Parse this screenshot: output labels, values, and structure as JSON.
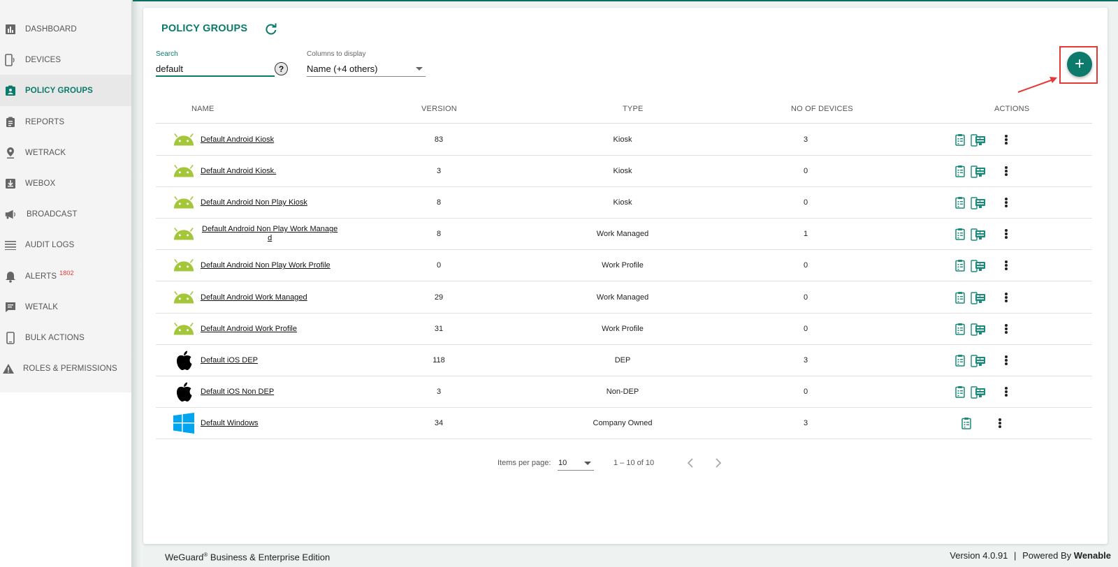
{
  "sidebar": {
    "items": [
      {
        "label": "DASHBOARD",
        "icon": "dashboard-icon"
      },
      {
        "label": "DEVICES",
        "icon": "devices-icon"
      },
      {
        "label": "POLICY GROUPS",
        "icon": "policy-groups-icon",
        "active": true
      },
      {
        "label": "REPORTS",
        "icon": "reports-icon"
      },
      {
        "label": "WETRACK",
        "icon": "location-pin-icon"
      },
      {
        "label": "WEBOX",
        "icon": "download-box-icon"
      },
      {
        "label": "BROADCAST",
        "icon": "megaphone-icon"
      },
      {
        "label": "AUDIT LOGS",
        "icon": "list-icon"
      },
      {
        "label": "ALERTS",
        "icon": "bell-icon",
        "badge": "1802"
      },
      {
        "label": "WETALK",
        "icon": "chat-icon"
      },
      {
        "label": "BULK ACTIONS",
        "icon": "phone-icon"
      },
      {
        "label": "ROLES & PERMISSIONS",
        "icon": "warning-icon"
      }
    ]
  },
  "header": {
    "title": "POLICY GROUPS",
    "refresh_icon": "refresh-icon"
  },
  "search": {
    "label": "Search",
    "value": "default",
    "help": "?"
  },
  "columns_select": {
    "label": "Columns to display",
    "value": "Name (+4 others)"
  },
  "add_button": {
    "label": "+",
    "icon": "plus-icon"
  },
  "table": {
    "headers": [
      "NAME",
      "VERSION",
      "TYPE",
      "NO OF DEVICES",
      "ACTIONS"
    ],
    "rows": [
      {
        "os": "android",
        "name": "Default Android Kiosk",
        "version": "83",
        "type": "Kiosk",
        "devices": "3"
      },
      {
        "os": "android",
        "name": "Default Android Kiosk.",
        "version": "3",
        "type": "Kiosk",
        "devices": "0"
      },
      {
        "os": "android",
        "name": "Default Android Non Play Kiosk",
        "version": "8",
        "type": "Kiosk",
        "devices": "0"
      },
      {
        "os": "android",
        "name": "Default Android Non Play Work Manage",
        "name2": "d",
        "version": "8",
        "type": "Work Managed",
        "devices": "1"
      },
      {
        "os": "android",
        "name": "Default Android Non Play Work Profile",
        "version": "0",
        "type": "Work Profile",
        "devices": "0"
      },
      {
        "os": "android",
        "name": "Default Android Work Managed",
        "version": "29",
        "type": "Work Managed",
        "devices": "0"
      },
      {
        "os": "android",
        "name": "Default Android Work Profile",
        "version": "31",
        "type": "Work Profile",
        "devices": "0"
      },
      {
        "os": "apple",
        "name": "Default iOS DEP",
        "version": "118",
        "type": "DEP",
        "devices": "3"
      },
      {
        "os": "apple",
        "name": "Default iOS Non DEP",
        "version": "3",
        "type": "Non-DEP",
        "devices": "0"
      },
      {
        "os": "windows",
        "name": "Default Windows",
        "version": "34",
        "type": "Company Owned",
        "devices": "3"
      }
    ]
  },
  "paginator": {
    "label": "Items per page:",
    "per_page": "10",
    "range": "1 – 10 of 10"
  },
  "footer": {
    "brand": "WeGuard",
    "reg": "®",
    "edition": " Business & Enterprise Edition",
    "version": "Version 4.0.91",
    "sep": "|",
    "powered": "Powered By",
    "company": "Wenable"
  },
  "colors": {
    "accent": "#0a7a6b",
    "android_green": "#a4c639",
    "windows_blue": "#00a4ef",
    "highlight_red": "#e53935"
  }
}
